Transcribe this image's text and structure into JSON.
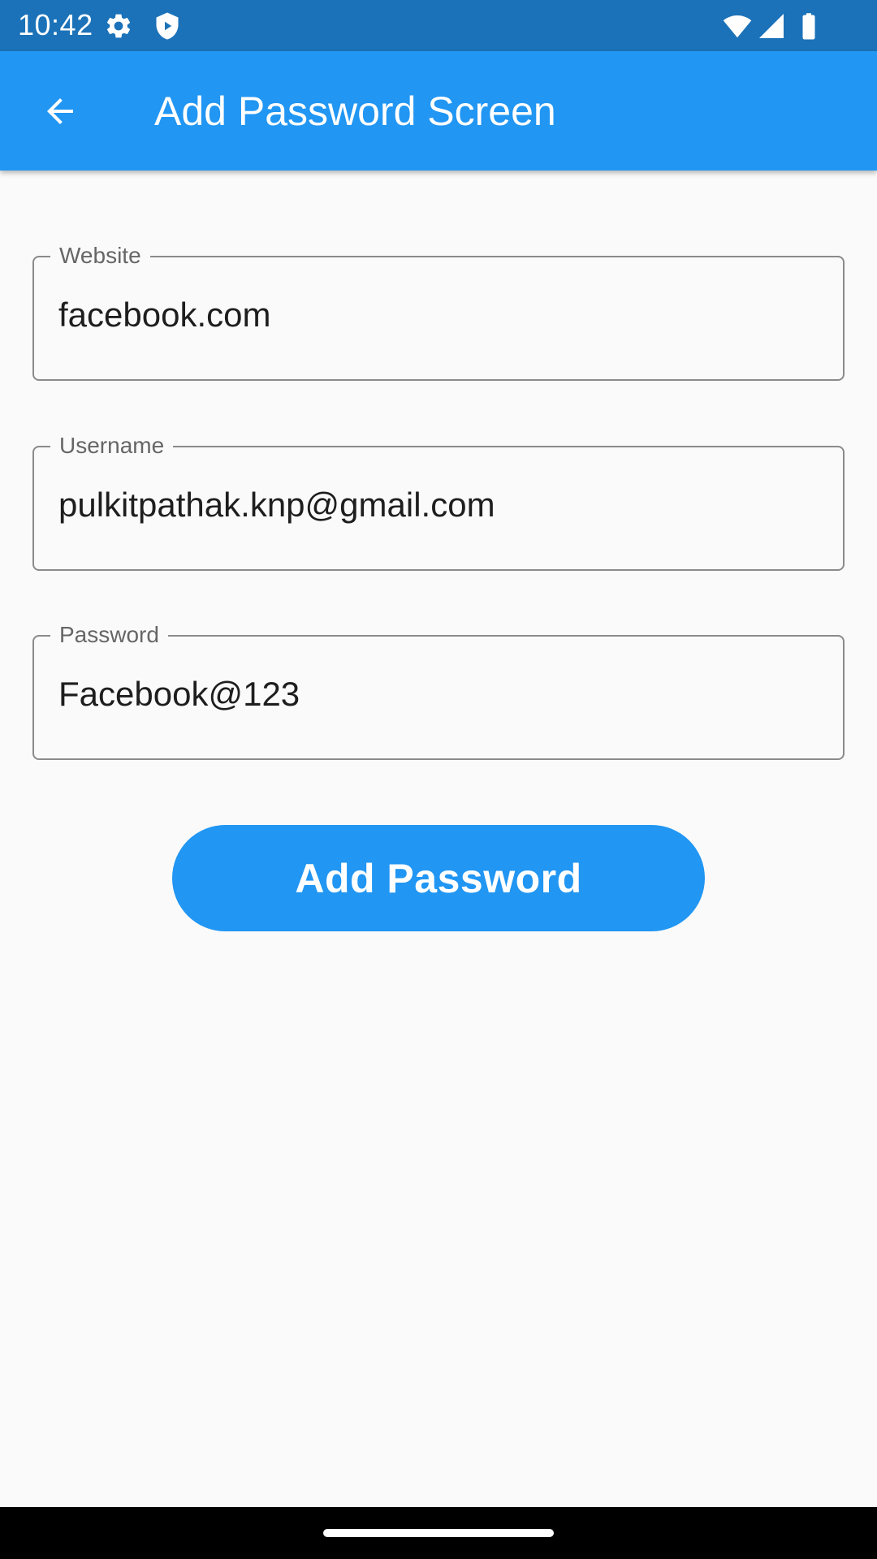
{
  "status_bar": {
    "time": "10:42",
    "icons": [
      "settings-icon",
      "shield-icon",
      "wifi-icon",
      "signal-icon",
      "battery-icon"
    ]
  },
  "app_bar": {
    "back_icon": "arrow-back-icon",
    "title": "Add Password Screen",
    "color": "#2196f3"
  },
  "form": {
    "website": {
      "label": "Website",
      "value": "facebook.com"
    },
    "username": {
      "label": "Username",
      "value": "pulkitpathak.knp@gmail.com"
    },
    "password": {
      "label": "Password",
      "value": "Facebook@123"
    }
  },
  "submit_button": {
    "label": "Add Password",
    "color": "#2196f3"
  }
}
